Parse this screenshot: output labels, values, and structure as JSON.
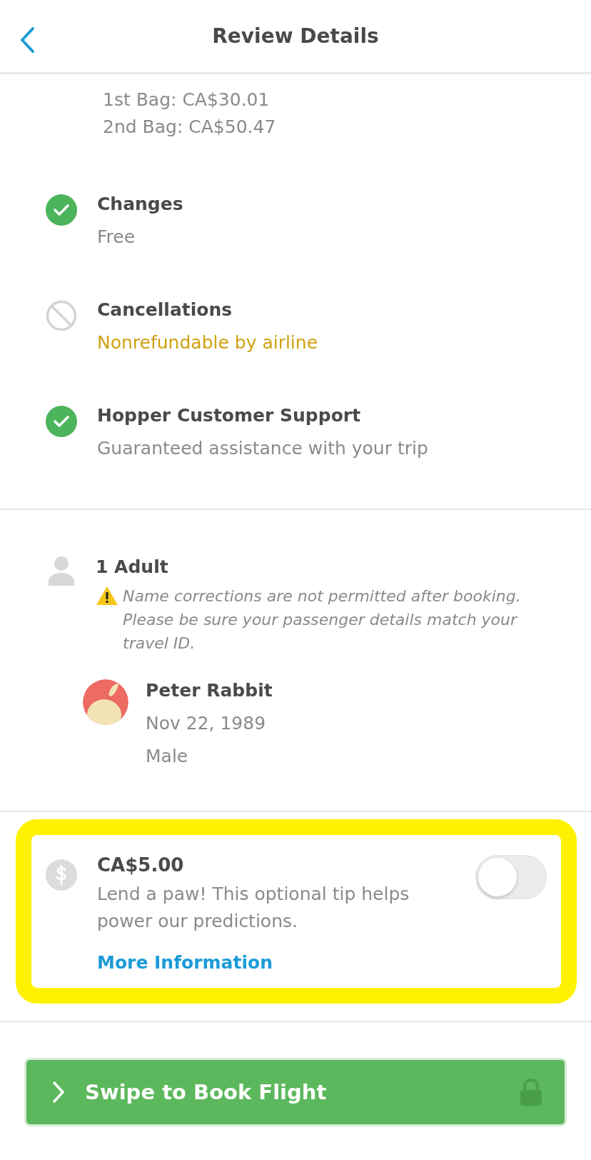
{
  "header": {
    "title": "Review Details"
  },
  "baggage": {
    "lines": [
      "1st Bag: CA$30.01",
      "2nd Bag: CA$50.47"
    ]
  },
  "policies": [
    {
      "kind": "included",
      "title": "Changes",
      "detail": "Free"
    },
    {
      "kind": "excluded",
      "title": "Cancellations",
      "detail": "Nonrefundable by airline"
    },
    {
      "kind": "included",
      "title": "Hopper Customer Support",
      "detail": "Guaranteed assistance with your trip"
    }
  ],
  "passengers": {
    "title": "1 Adult",
    "warning": "Name corrections are not permitted after booking. Please be sure your passenger details match your travel ID.",
    "traveler": {
      "name": "Peter Rabbit",
      "birthdate": "Nov 22, 1989",
      "gender": "Male"
    }
  },
  "tip": {
    "amount": "CA$5.00",
    "description": "Lend a paw! This optional tip helps power our predictions.",
    "link": "More Information",
    "on": false,
    "highlighted": true
  },
  "book_button": {
    "label": "Swipe to Book Flight"
  }
}
